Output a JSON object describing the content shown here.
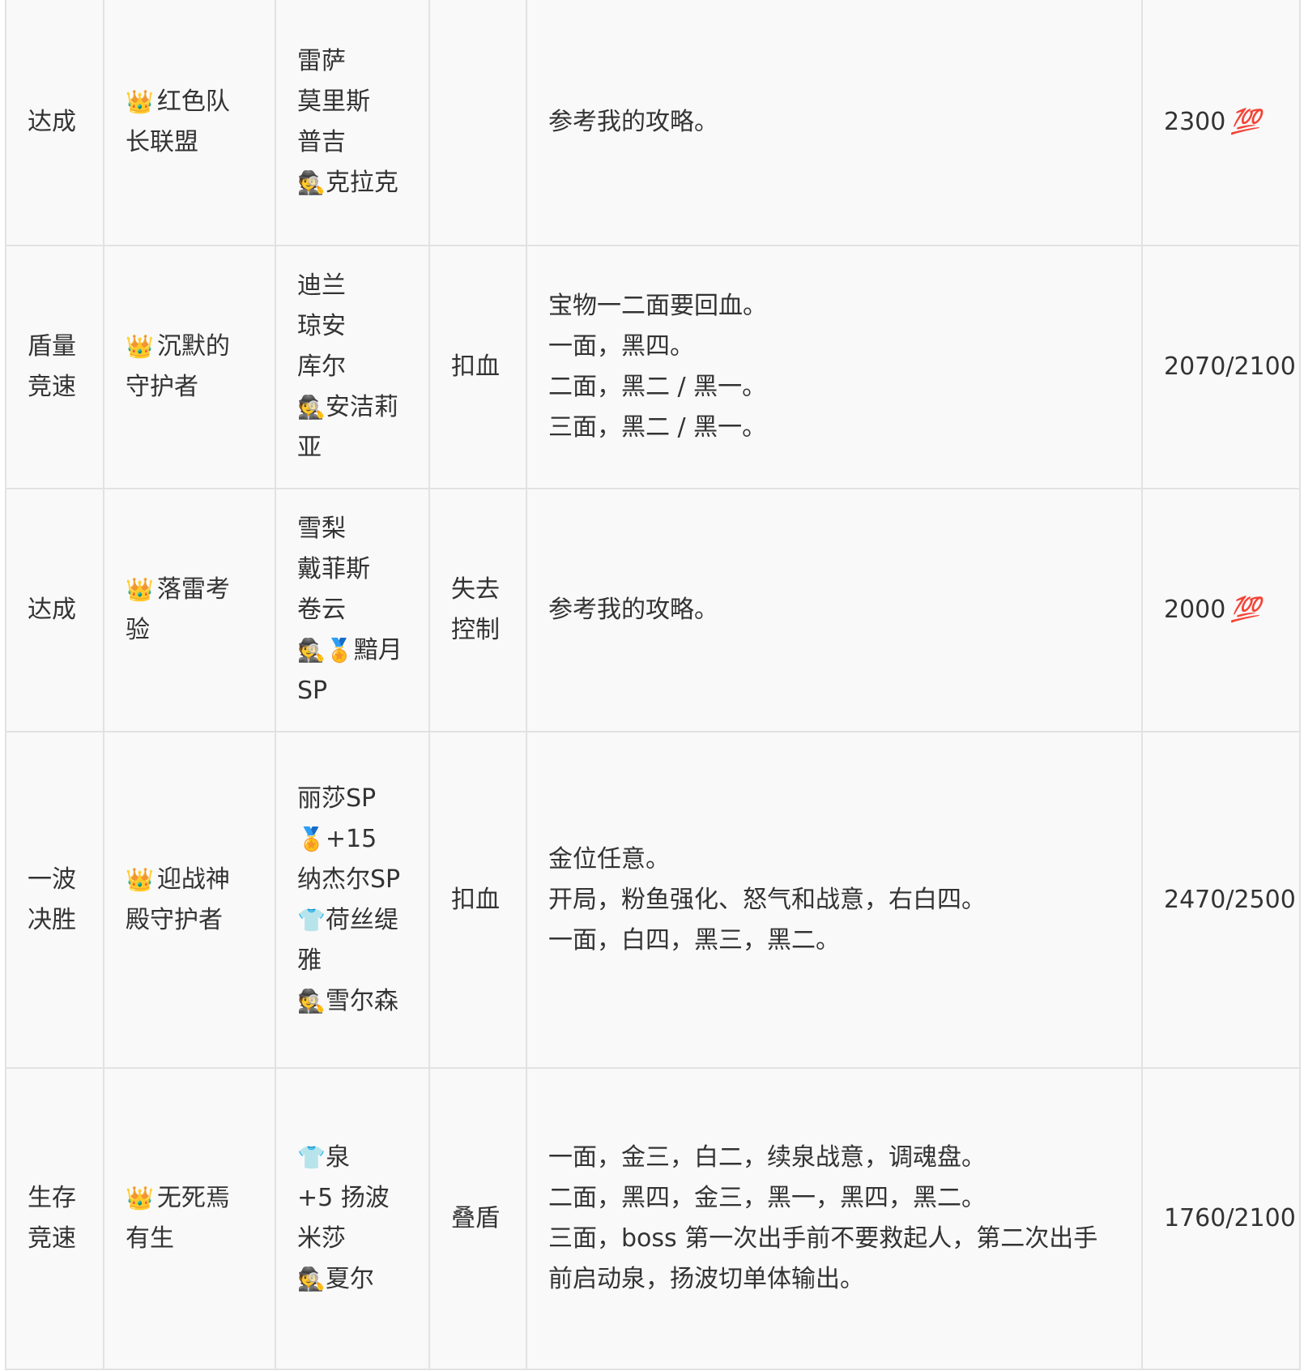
{
  "rows": [
    {
      "result": "达成",
      "crown_icon": "👑",
      "name": "红色队长联盟",
      "team": [
        {
          "icon": "",
          "text": "雷萨"
        },
        {
          "icon": "",
          "text": "莫里斯"
        },
        {
          "icon": "",
          "text": "普吉"
        },
        {
          "icon": "🕵",
          "text": "克拉克"
        }
      ],
      "tag": "",
      "notes": [
        "参考我的攻略。"
      ],
      "score": "2300",
      "score_badge": "💯",
      "height": 324
    },
    {
      "result": "盾量竞速",
      "crown_icon": "👑",
      "name": "沉默的守护者",
      "team": [
        {
          "icon": "",
          "text": "迪兰"
        },
        {
          "icon": "",
          "text": "琼安"
        },
        {
          "icon": "",
          "text": "库尔"
        },
        {
          "icon": "🕵",
          "text": "安洁莉亚"
        }
      ],
      "tag": "扣血",
      "notes": [
        "宝物一二面要回血。",
        "一面，黑四。",
        "二面，黑二 / 黑一。",
        "三面，黑二 / 黑一。"
      ],
      "score": "2070/2100",
      "score_badge": "",
      "height": 324
    },
    {
      "result": "达成",
      "crown_icon": "👑",
      "name": "落雷考验",
      "team": [
        {
          "icon": "",
          "text": "雪梨"
        },
        {
          "icon": "",
          "text": "戴菲斯"
        },
        {
          "icon": "",
          "text": "卷云"
        },
        {
          "icon": "🕵🏅",
          "text": "黯月SP"
        }
      ],
      "tag": "失去控制",
      "notes": [
        "参考我的攻略。"
      ],
      "score": "2000",
      "score_badge": "💯",
      "height": 324
    },
    {
      "result": "一波决胜",
      "crown_icon": "👑",
      "name": "迎战神殿守护者",
      "team": [
        {
          "icon": "",
          "text": "丽莎SP"
        },
        {
          "icon": "🏅",
          "text": "+15 纳杰尔SP"
        },
        {
          "icon": "👕",
          "text": "荷丝缇雅"
        },
        {
          "icon": "🕵",
          "text": "雪尔森"
        }
      ],
      "tag": "扣血",
      "notes": [
        "金位任意。",
        "开局，粉鱼强化、怒气和战意，右白四。",
        "一面，白四，黑三，黑二。"
      ],
      "score": "2470/2500",
      "score_badge": "",
      "height": 448
    },
    {
      "result": "生存竞速",
      "crown_icon": "👑",
      "name": "无死焉有生",
      "team": [
        {
          "icon": "👕",
          "text": "泉"
        },
        {
          "icon": "",
          "text": "+5 扬波"
        },
        {
          "icon": "",
          "text": "米莎"
        },
        {
          "icon": "🕵",
          "text": "夏尔"
        }
      ],
      "tag": "叠盾",
      "notes": [
        "一面，金三，白二，续泉战意，调魂盘。",
        "二面，黑四，金三，黑一，黑四，黑二。",
        "三面，boss 第一次出手前不要救起人，第二次出手前启动泉，扬波切单体输出。"
      ],
      "score": "1760/2100",
      "score_badge": "",
      "height": 280
    }
  ]
}
